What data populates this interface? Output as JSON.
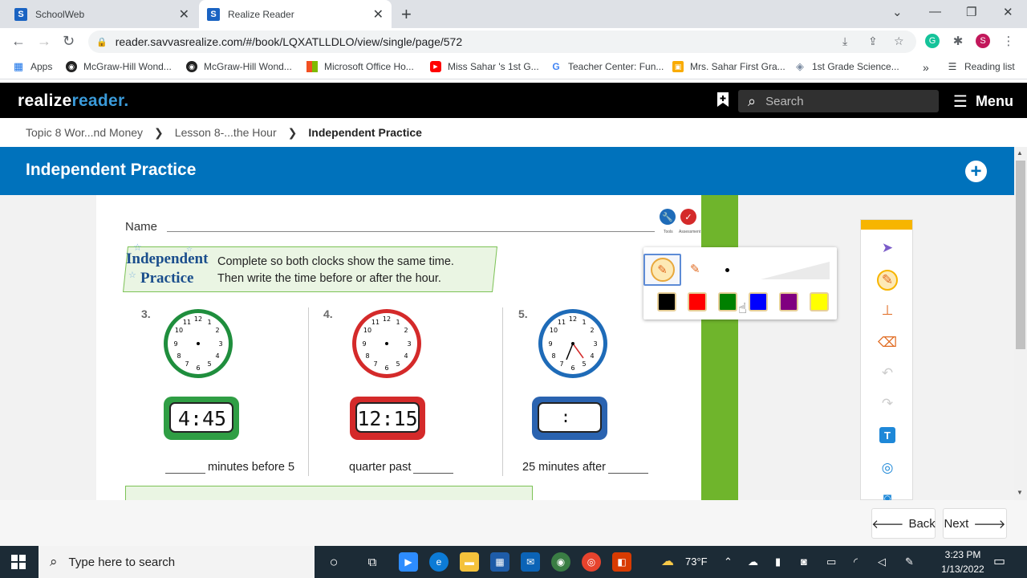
{
  "browser": {
    "tabs": [
      {
        "title": "SchoolWeb",
        "favicon": "S"
      },
      {
        "title": "Realize Reader",
        "favicon": "S"
      }
    ],
    "close_glyph": "✕",
    "newtab_glyph": "+",
    "url": "reader.savvasrealize.com/#/book/LQXATLLDLO/view/single/page/572",
    "profile_initial": "S",
    "bookmarks": [
      {
        "label": "Apps"
      },
      {
        "label": "McGraw-Hill Wond..."
      },
      {
        "label": "McGraw-Hill Wond..."
      },
      {
        "label": "Microsoft Office Ho..."
      },
      {
        "label": "Miss Sahar 's 1st G..."
      },
      {
        "label": "Teacher Center: Fun..."
      },
      {
        "label": "Mrs. Sahar First Gra..."
      },
      {
        "label": "1st Grade Science..."
      }
    ],
    "bookmarks_overflow": "»",
    "reading_list": "Reading list"
  },
  "app": {
    "logo_realize": "realize",
    "logo_reader": "reader.",
    "search_placeholder": "Search",
    "menu_label": "Menu"
  },
  "breadcrumb": {
    "items": [
      "Topic 8 Wor...nd Money",
      "Lesson 8-...the Hour",
      "Independent Practice"
    ],
    "separator": "❯"
  },
  "banner": {
    "title": "Independent Practice",
    "plus": "+"
  },
  "worksheet": {
    "name_label": "Name",
    "tools_label": "Tools",
    "assessment_label": "Assessment",
    "ip_title_1": "Independent",
    "ip_title_2": "Practice",
    "instruction_1": "Complete so both clocks show the same time.",
    "instruction_2": "Then write the time before or after the hour.",
    "problems": [
      {
        "number": "3.",
        "digital": "4:45",
        "answer_after": "minutes before 5"
      },
      {
        "number": "4.",
        "digital": "12:15",
        "answer_before": "quarter past"
      },
      {
        "number": "5.",
        "digital": ":",
        "answer_before": "25 minutes after"
      }
    ]
  },
  "pen_popup": {
    "colors": [
      "#000000",
      "#ff0000",
      "#008000",
      "#0000ff",
      "#800080",
      "#ffff00"
    ]
  },
  "toolbar": {
    "icons": [
      "pointer-icon",
      "pen-icon",
      "stamp-icon",
      "eraser-icon",
      "undo-icon",
      "redo-icon",
      "text-box-icon",
      "shape-icon",
      "camera-icon"
    ]
  },
  "footer": {
    "back_label": "Back",
    "next_label": "Next"
  },
  "taskbar": {
    "search_placeholder": "Type here to search",
    "temperature": "73°F",
    "time": "3:23 PM",
    "date": "1/13/2022"
  }
}
